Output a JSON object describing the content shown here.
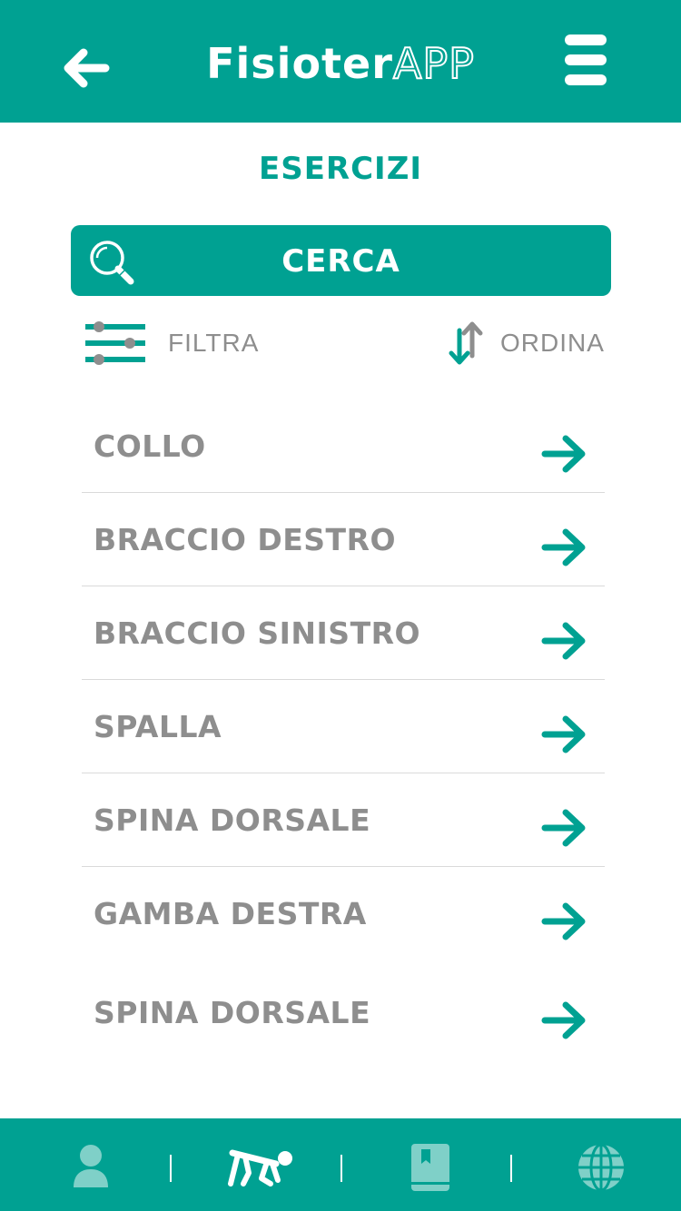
{
  "header": {
    "brand_main": "Fisioter",
    "brand_accent": "APP"
  },
  "page": {
    "title": "ESERCIZI"
  },
  "search": {
    "label": "CERCA"
  },
  "toolbar": {
    "filter_label": "FILTRA",
    "sort_label": "ORDINA"
  },
  "list": {
    "items": [
      {
        "label": "COLLO"
      },
      {
        "label": "BRACCIO DESTRO"
      },
      {
        "label": "BRACCIO SINISTRO"
      },
      {
        "label": "SPALLA"
      },
      {
        "label": "SPINA DORSALE"
      },
      {
        "label": "GAMBA DESTRA"
      },
      {
        "label": "SPINA DORSALE"
      }
    ]
  },
  "bottom_nav": {
    "items": [
      {
        "icon": "user-icon",
        "active": false
      },
      {
        "icon": "exercise-icon",
        "active": true
      },
      {
        "icon": "book-icon",
        "active": false
      },
      {
        "icon": "globe-icon",
        "active": false
      }
    ]
  },
  "colors": {
    "primary": "#00a192",
    "text_muted": "#8e8e8e",
    "inactive_icon": "#7fd0c8"
  }
}
